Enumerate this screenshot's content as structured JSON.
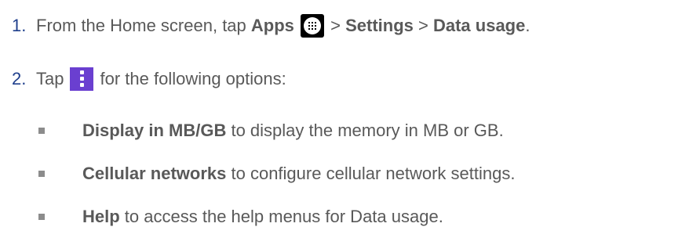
{
  "steps": [
    {
      "number": "1.",
      "pre": "From the Home screen, tap ",
      "apps": "Apps",
      "sep1": " > ",
      "settings": "Settings",
      "sep2": " > ",
      "data_usage": "Data usage",
      "end": ".",
      "icon": "apps-launcher-icon"
    },
    {
      "number": "2.",
      "pre": "Tap",
      "post": "for the following options:",
      "icon": "menu-overflow-icon"
    }
  ],
  "options": [
    {
      "term": "Display in MB/GB",
      "desc": " to display the memory in MB or GB."
    },
    {
      "term": "Cellular networks",
      "desc": " to configure cellular network settings."
    },
    {
      "term": "Help",
      "desc": " to access the help menus for Data usage."
    }
  ],
  "colors": {
    "text": "#595959",
    "number": "#1f3f8c",
    "menu_icon_bg": "#6a3fd0",
    "bullet": "#8c8c8c"
  }
}
